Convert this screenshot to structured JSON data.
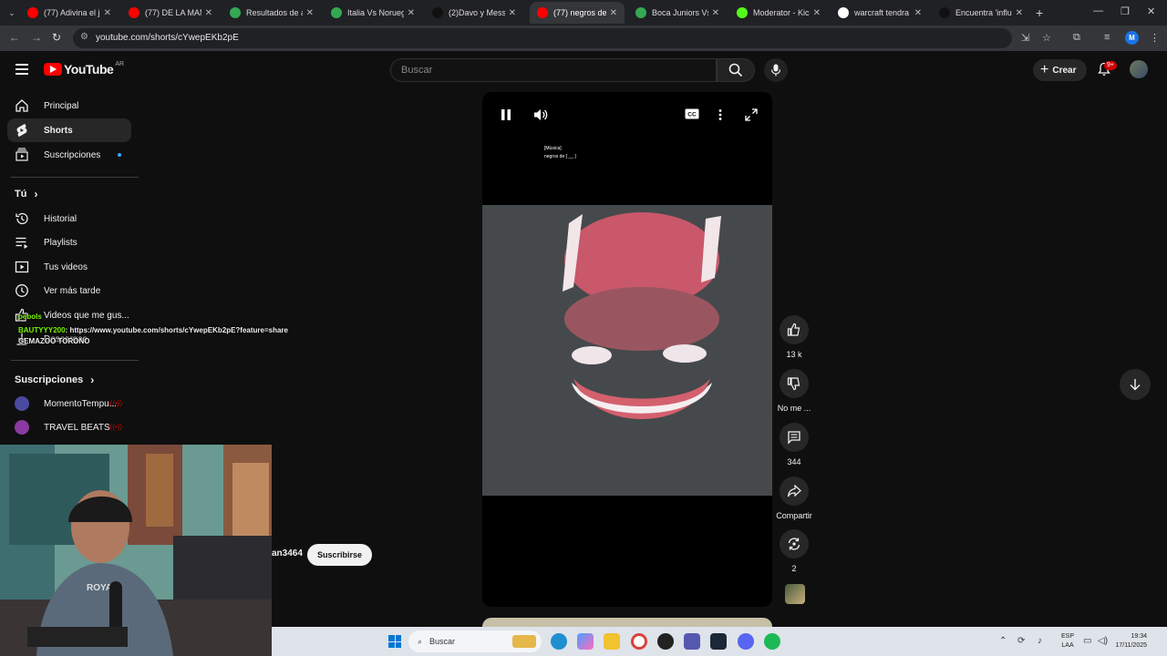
{
  "browser": {
    "tabs": [
      {
        "title": "(77) Adivina el jug",
        "fav": "yt",
        "active": false
      },
      {
        "title": "(77) DE LA MANO",
        "fav": "yt",
        "active": false
      },
      {
        "title": "Resultados de ay",
        "fav": "g",
        "active": false
      },
      {
        "title": "Italia Vs Noruega",
        "fav": "g",
        "active": false
      },
      {
        "title": "(2)Davo y Messi",
        "fav": "tt",
        "active": false
      },
      {
        "title": "(77) negros de",
        "fav": "yt",
        "active": true
      },
      {
        "title": "Boca Juniors Vs T",
        "fav": "g",
        "active": false
      },
      {
        "title": "Moderator - Kick",
        "fav": "kick",
        "active": false
      },
      {
        "title": "warcraft tendra",
        "fav": "google",
        "active": false
      },
      {
        "title": "Encuentra 'influen",
        "fav": "tt",
        "active": false
      }
    ],
    "url": "youtube.com/shorts/cYwepEKb2pE",
    "profile_initial": "M"
  },
  "youtube": {
    "logo_text": "YouTube",
    "region": "AR",
    "search_placeholder": "Buscar",
    "create_label": "Crear",
    "notif_badge": "9+"
  },
  "sidebar": {
    "items": [
      {
        "label": "Principal",
        "icon": "home-icon"
      },
      {
        "label": "Shorts",
        "icon": "shorts-icon"
      },
      {
        "label": "Suscripciones",
        "icon": "subscriptions-icon"
      }
    ],
    "you_section": "Tú",
    "you_items": [
      {
        "label": "Historial",
        "icon": "history-icon"
      },
      {
        "label": "Playlists",
        "icon": "playlist-icon"
      },
      {
        "label": "Tus videos",
        "icon": "your-videos-icon"
      },
      {
        "label": "Ver más tarde",
        "icon": "watch-later-icon"
      },
      {
        "label": "Videos que me gus...",
        "icon": "liked-icon"
      },
      {
        "label": "Descargas",
        "icon": "downloads-icon"
      }
    ],
    "subs_section": "Suscripciones",
    "subs": [
      {
        "label": "MomentoTempu...",
        "color": "#4a4aa0"
      },
      {
        "label": "TRAVEL BEATS",
        "color": "#8a3aa0"
      }
    ]
  },
  "chat": {
    "line1_user": "pebols",
    "line2_user": "BAUTYYY200",
    "line2_text": ": https://www.youtube.com/shorts/cYwepEKb2pE?feature=share",
    "line3_text": "GEMAZOO TORONO"
  },
  "short": {
    "caption_line1": "[Música]",
    "caption_line2": "negros de [ __ ]",
    "channel": "an3464",
    "subscribe_label": "Suscribirse",
    "likes": "13 k",
    "dislike_label": "No me ...",
    "comments": "344",
    "share_label": "Compartir",
    "remix_count": "2"
  },
  "taskbar": {
    "search": "Buscar",
    "lang_top": "ESP",
    "lang_bottom": "LAA",
    "time": "19:34",
    "date": "17/11/2025"
  }
}
